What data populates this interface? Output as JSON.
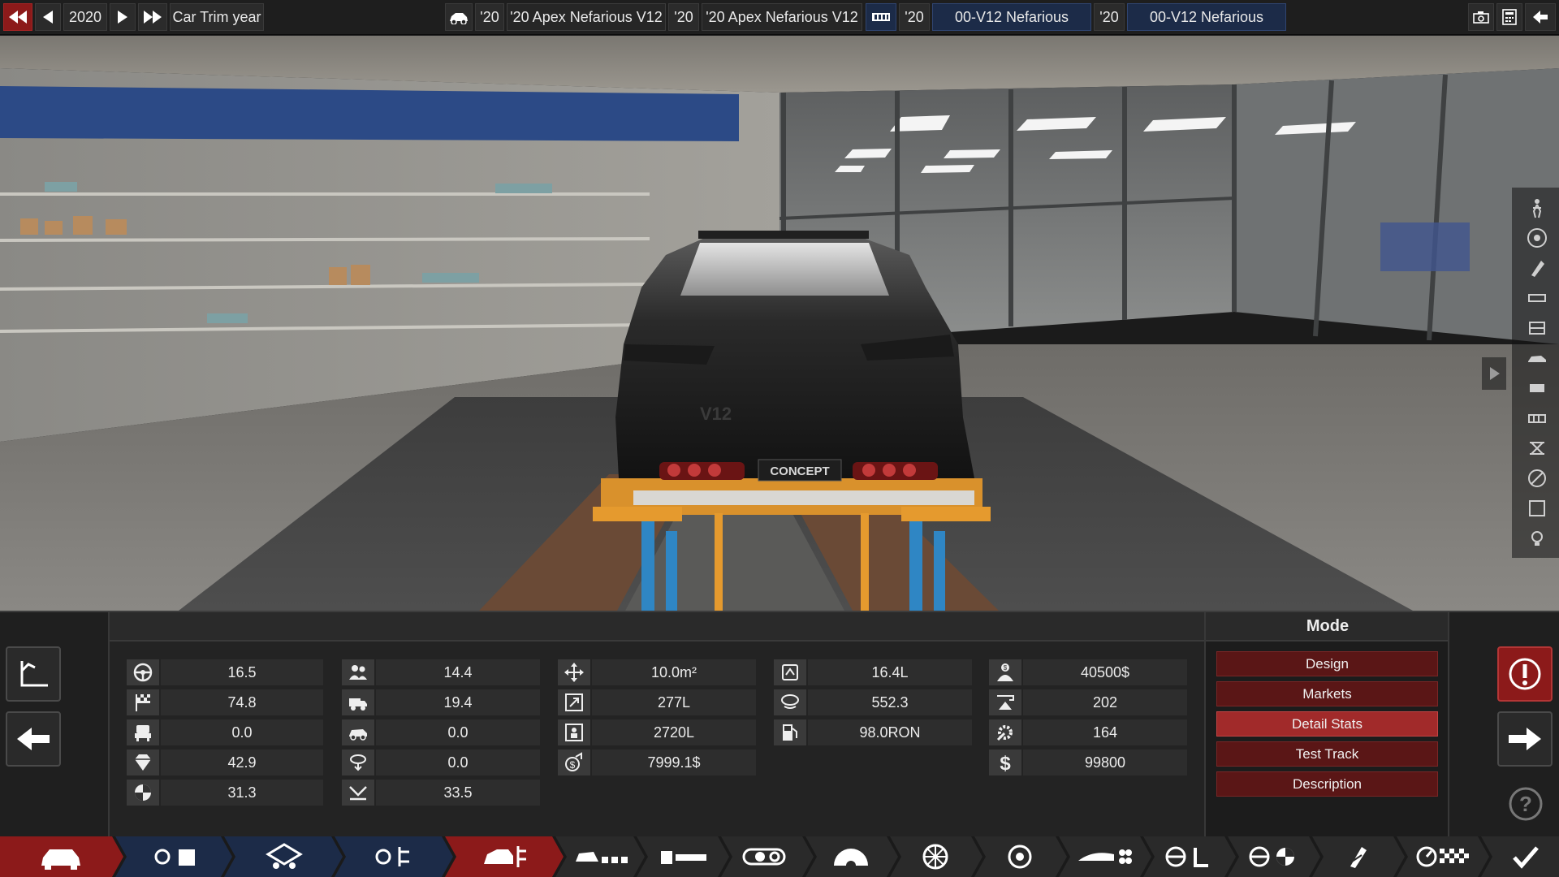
{
  "topbar": {
    "year": "2020",
    "trim_year_label": "Car Trim year",
    "model_year_1": "'20",
    "model_name_1": "'20 Apex Nefarious V12",
    "model_year_2": "'20",
    "model_name_2": "'20 Apex Nefarious V12",
    "engine_year_1": "'20",
    "engine_name_1": "00-V12 Nefarious",
    "engine_year_2": "'20",
    "engine_name_2": "00-V12 Nefarious"
  },
  "scene": {
    "plate_text": "CONCEPT",
    "badge_text": "V12"
  },
  "stats": {
    "col1": [
      "16.5",
      "74.8",
      "0.0",
      "42.9",
      "31.3"
    ],
    "col2": [
      "14.4",
      "19.4",
      "0.0",
      "0.0",
      "33.5"
    ],
    "col3": [
      "10.0m²",
      "277L",
      "2720L",
      "7999.1$"
    ],
    "col4": [
      "16.4L",
      "552.3",
      "98.0RON"
    ],
    "col5": [
      "40500$",
      "202",
      "164",
      "99800"
    ]
  },
  "mode": {
    "title": "Mode",
    "buttons": [
      "Design",
      "Markets",
      "Detail Stats",
      "Test Track",
      "Description"
    ],
    "active_index": 2
  },
  "colors": {
    "accent_red": "#8c1a1a",
    "active_red": "#a12a2a",
    "blue_tab": "#1c2b48",
    "panel": "#232323"
  },
  "tabs": {
    "icons": [
      "car-body-icon",
      "project-icon",
      "engine-family-icon",
      "engine-variant-icon",
      "trim-car-icon",
      "chassis-icon",
      "suspension-icon",
      "drivetrain-icon",
      "wheels-icon",
      "tyres-icon",
      "brakes-icon",
      "aero-icon",
      "interior-icon",
      "safety-icon",
      "fuel-system-icon",
      "testing-icon",
      "finish-icon"
    ],
    "active_index": 4
  }
}
